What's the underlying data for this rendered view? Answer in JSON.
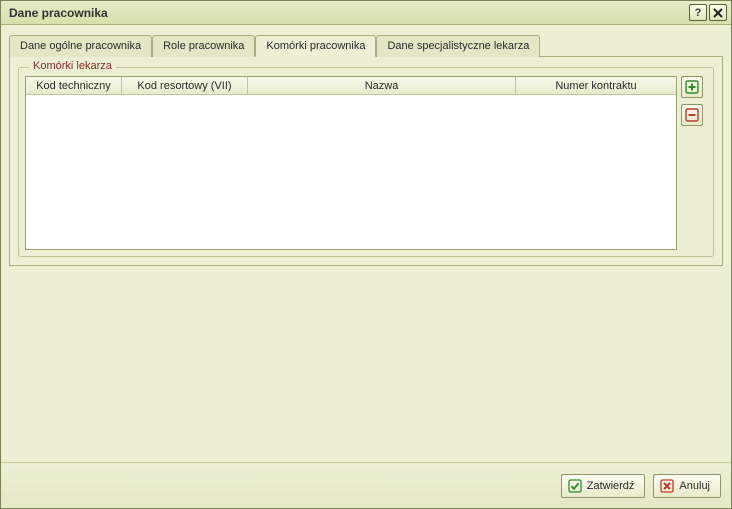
{
  "window": {
    "title": "Dane pracownika"
  },
  "tabs": [
    {
      "label": "Dane ogólne pracownika"
    },
    {
      "label": "Role pracownika"
    },
    {
      "label": "Komórki pracownika"
    },
    {
      "label": "Dane specjalistyczne lekarza"
    }
  ],
  "active_tab_index": 2,
  "group": {
    "legend": "Komórki lekarza"
  },
  "table": {
    "columns": [
      {
        "label": "Kod techniczny"
      },
      {
        "label": "Kod resortowy (VII)"
      },
      {
        "label": "Nazwa"
      },
      {
        "label": "Numer kontraktu"
      }
    ],
    "rows": []
  },
  "side_buttons": {
    "add": "+",
    "remove": "−"
  },
  "footer": {
    "confirm_label": "Zatwierdź",
    "cancel_label": "Anuluj"
  },
  "colors": {
    "plus": "#2e8b2e",
    "minus": "#c0392b",
    "accent_border": "#8f9566"
  }
}
